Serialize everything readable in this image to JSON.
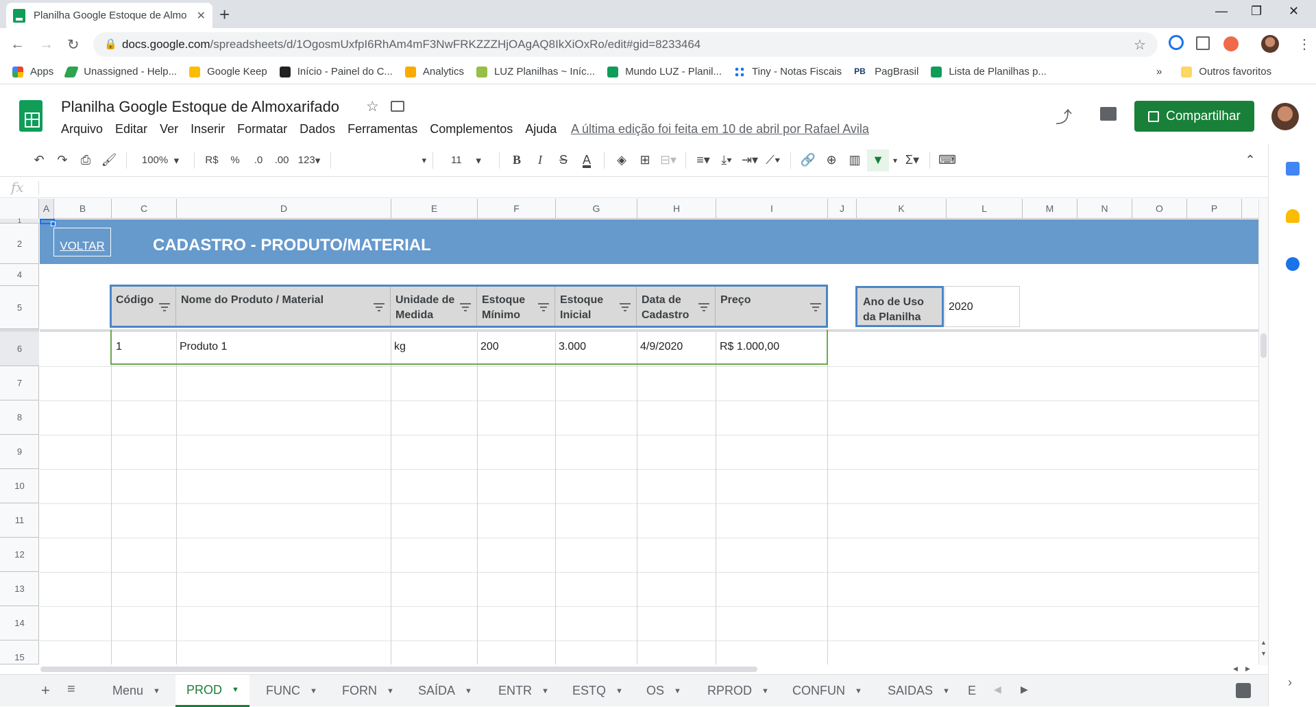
{
  "browser": {
    "tab_title": "Planilha Google Estoque de Almo",
    "url_host": "docs.google.com",
    "url_path": "/spreadsheets/d/1OgosmUxfpI6RhAm4mF3NwFRKZZZHjOAgAQ8IkXiOxRo/edit#gid=8233464",
    "bookmarks": [
      "Apps",
      "Unassigned - Help...",
      "Google Keep",
      "Início - Painel do C...",
      "Analytics",
      "LUZ Planilhas ~ Iníc...",
      "Mundo LUZ - Planil...",
      "Tiny - Notas Fiscais",
      "PagBrasil",
      "Lista de Planilhas p..."
    ],
    "bookmarks_more": "»",
    "other_bookmarks": "Outros favoritos"
  },
  "doc": {
    "title": "Planilha Google Estoque de Almoxarifado",
    "menus": [
      "Arquivo",
      "Editar",
      "Ver",
      "Inserir",
      "Formatar",
      "Dados",
      "Ferramentas",
      "Complementos",
      "Ajuda"
    ],
    "last_edit": "A última edição foi feita em 10 de abril por Rafael Avila",
    "share_label": "Compartilhar"
  },
  "toolbar": {
    "zoom": "100%",
    "currency": "R$",
    "percent": "%",
    "dec_less": ".0",
    "dec_more": ".00",
    "format_more": "123",
    "font_size": "11"
  },
  "columns": [
    "A",
    "B",
    "C",
    "D",
    "E",
    "F",
    "G",
    "H",
    "I",
    "J",
    "K",
    "L",
    "M",
    "N",
    "O",
    "P"
  ],
  "rows": [
    "1",
    "2",
    "4",
    "5",
    "6",
    "7",
    "8",
    "9",
    "10",
    "11",
    "12",
    "13",
    "14",
    "15"
  ],
  "sheet": {
    "voltar": "VOLTAR",
    "banner_title": "CADASTRO - PRODUTO/MATERIAL",
    "headers": [
      "Código",
      "Nome do Produto / Material",
      "Unidade de Medida",
      "Estoque Mínimo",
      "Estoque Inicial",
      "Data de Cadastro",
      "Preço"
    ],
    "row": [
      "1",
      "Produto 1",
      "kg",
      "200",
      "3.000",
      "4/9/2020",
      "R$ 1.000,00"
    ],
    "ano_label": "Ano de Uso da Planilha",
    "ano_value": "2020"
  },
  "sheet_tabs": [
    "Menu",
    "PROD",
    "FUNC",
    "FORN",
    "SAÍDA",
    "ENTR",
    "ESTQ",
    "OS",
    "RPROD",
    "CONFUN",
    "SAIDAS",
    "E"
  ],
  "active_tab": "PROD",
  "colors": {
    "banner": "#6699cc",
    "header_fill": "#d9d9d9",
    "share_green": "#188038"
  }
}
